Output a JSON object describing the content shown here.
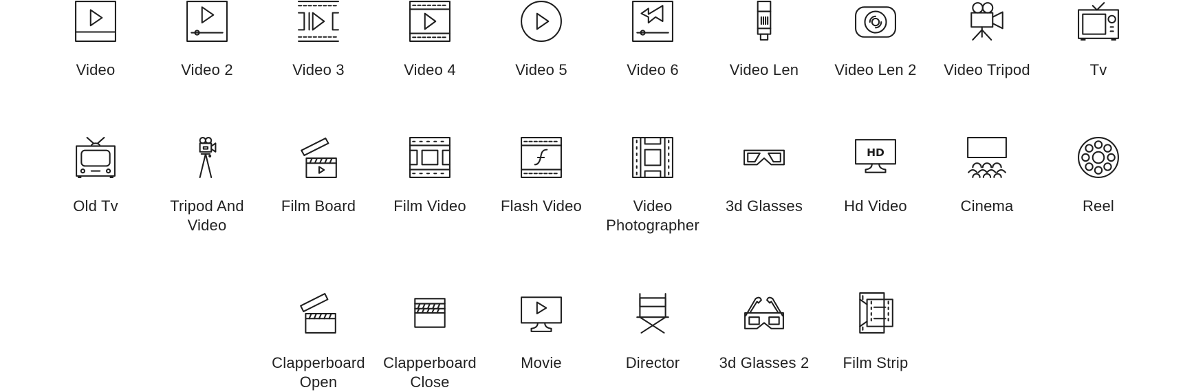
{
  "icons": [
    {
      "label": "Video",
      "icon": "video-icon"
    },
    {
      "label": "Video 2",
      "icon": "video-2-icon"
    },
    {
      "label": "Video 3",
      "icon": "video-3-icon"
    },
    {
      "label": "Video 4",
      "icon": "video-4-icon"
    },
    {
      "label": "Video 5",
      "icon": "video-5-icon"
    },
    {
      "label": "Video 6",
      "icon": "video-6-icon"
    },
    {
      "label": "Video Len",
      "icon": "video-len-icon"
    },
    {
      "label": "Video Len 2",
      "icon": "video-len-2-icon"
    },
    {
      "label": "Video Tripod",
      "icon": "video-tripod-icon"
    },
    {
      "label": "Tv",
      "icon": "tv-icon"
    },
    {
      "label": "Old Tv",
      "icon": "old-tv-icon"
    },
    {
      "label": "Tripod And Video",
      "icon": "tripod-and-video-icon"
    },
    {
      "label": "Film Board",
      "icon": "film-board-icon"
    },
    {
      "label": "Film Video",
      "icon": "film-video-icon"
    },
    {
      "label": "Flash Video",
      "icon": "flash-video-icon"
    },
    {
      "label": "Video Photographer",
      "icon": "video-photographer-icon"
    },
    {
      "label": "3d Glasses",
      "icon": "3d-glasses-icon"
    },
    {
      "label": "Hd Video",
      "icon": "hd-video-icon",
      "badge": "HD"
    },
    {
      "label": "Cinema",
      "icon": "cinema-icon"
    },
    {
      "label": "Reel",
      "icon": "reel-icon"
    },
    {
      "label": "Clapperboard Open",
      "icon": "clapperboard-open-icon"
    },
    {
      "label": "Clapperboard Close",
      "icon": "clapperboard-close-icon"
    },
    {
      "label": "Movie",
      "icon": "movie-icon"
    },
    {
      "label": "Director",
      "icon": "director-icon"
    },
    {
      "label": "3d Glasses 2",
      "icon": "3d-glasses-2-icon"
    },
    {
      "label": "Film Strip",
      "icon": "film-strip-icon"
    }
  ]
}
